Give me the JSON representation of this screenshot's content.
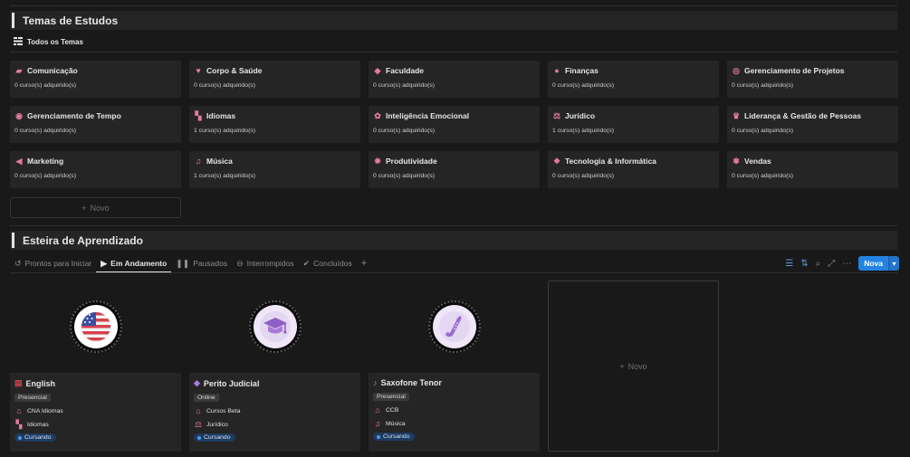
{
  "sections": {
    "themes_title": "Temas de Estudos",
    "path_title": "Esteira de Aprendizado"
  },
  "themes_view": {
    "label": "Todos os Temas",
    "icon": "list-icon"
  },
  "themes": [
    {
      "name": "Comunicação",
      "count": "0 curso(s) adquirido(s)",
      "icon": "chat-icon"
    },
    {
      "name": "Corpo & Saúde",
      "count": "0 curso(s) adquirido(s)",
      "icon": "heart-icon"
    },
    {
      "name": "Faculdade",
      "count": "0 curso(s) adquirido(s)",
      "icon": "graduation-cap-icon"
    },
    {
      "name": "Finanças",
      "count": "0 curso(s) adquirido(s)",
      "icon": "money-bag-icon"
    },
    {
      "name": "Gerenciamento de Projetos",
      "count": "0 curso(s) adquirido(s)",
      "icon": "target-icon"
    },
    {
      "name": "Gerenciamento de Tempo",
      "count": "0 curso(s) adquirido(s)",
      "icon": "alarm-icon"
    },
    {
      "name": "Idiomas",
      "count": "1 curso(s) adquirido(s)",
      "icon": "translate-icon"
    },
    {
      "name": "Inteligência Emocional",
      "count": "0 curso(s) adquirido(s)",
      "icon": "brain-icon"
    },
    {
      "name": "Jurídico",
      "count": "1 curso(s) adquirido(s)",
      "icon": "scales-icon"
    },
    {
      "name": "Liderança & Gestão de Pessoas",
      "count": "0 curso(s) adquirido(s)",
      "icon": "crown-icon"
    },
    {
      "name": "Marketing",
      "count": "0 curso(s) adquirido(s)",
      "icon": "megaphone-icon"
    },
    {
      "name": "Música",
      "count": "1 curso(s) adquirido(s)",
      "icon": "music-note-icon"
    },
    {
      "name": "Produtividade",
      "count": "0 curso(s) adquirido(s)",
      "icon": "gear-icon"
    },
    {
      "name": "Tecnologia & Informática",
      "count": "0 curso(s) adquirido(s)",
      "icon": "chip-icon"
    },
    {
      "name": "Vendas",
      "count": "0 curso(s) adquirido(s)",
      "icon": "handshake-icon"
    }
  ],
  "new_label": "Novo",
  "tabs": [
    {
      "label": "Prontos para Iniciar",
      "icon": "history-icon",
      "active": false
    },
    {
      "label": "Em Andamento",
      "icon": "play-icon",
      "active": true
    },
    {
      "label": "Pausados",
      "icon": "pause-icon",
      "active": false
    },
    {
      "label": "Interrompidos",
      "icon": "stop-icon",
      "active": false
    },
    {
      "label": "Concluídos",
      "icon": "check-circle-icon",
      "active": false
    }
  ],
  "toolbar": {
    "new_button": "Nova"
  },
  "courses": [
    {
      "name": "English",
      "mode": "Presencial",
      "school": "CNA Idiomas",
      "theme": "Idiomas",
      "status": "Cursando",
      "icon": "us-flag-icon"
    },
    {
      "name": "Perito Judicial",
      "mode": "Online",
      "school": "Cursos Beta",
      "theme": "Jurídico",
      "status": "Cursando",
      "icon": "graduation-cap-icon"
    },
    {
      "name": "Saxofone Tenor",
      "mode": "Presencial",
      "school": "CCB",
      "theme": "Música",
      "status": "Cursando",
      "icon": "saxophone-icon"
    }
  ],
  "colors": {
    "accent": "#2383e2",
    "theme_icon": "#e27aa0",
    "status_dot": "#4d9be6",
    "background": "#191919",
    "card": "#252525"
  }
}
